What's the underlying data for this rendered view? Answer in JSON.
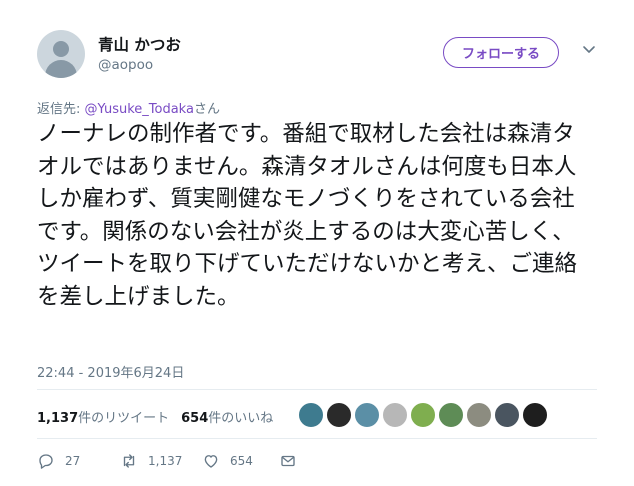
{
  "user": {
    "name": "青山 かつお",
    "handle": "@aopoo",
    "avatar_icon": "default-avatar-icon"
  },
  "follow_button": {
    "label": "フォローする",
    "color": "#794bc4"
  },
  "reply": {
    "prefix": "返信先: ",
    "mention": "@Yusuke_Todaka",
    "suffix": "さん"
  },
  "tweet": {
    "text": "ノーナレの制作者です。番組で取材した会社は森清タオルではありません。森清タオルさんは何度も日本人しか雇わず、質実剛健なモノづくりをされている会社です。関係のない会社が炎上するのは大変心苦しく、ツイートを取り下げていただけないかと考え、ご連絡を差し上げました。",
    "timestamp": "22:44 - 2019年6月24日"
  },
  "stats": {
    "retweets_count": "1,137",
    "retweets_label": "件のリツイート",
    "likes_count": "654",
    "likes_label": "件のいいね"
  },
  "likers": [
    {
      "color": "#3e7b8f"
    },
    {
      "color": "#2a2a2a"
    },
    {
      "color": "#5b8fa6"
    },
    {
      "color": "#b7b7b7"
    },
    {
      "color": "#7fae4f"
    },
    {
      "color": "#5e8c56"
    },
    {
      "color": "#8c8c80"
    },
    {
      "color": "#4a5560"
    },
    {
      "color": "#1e1e1e"
    }
  ],
  "actions": {
    "reply_count": "27",
    "retweet_count": "1,137",
    "like_count": "654"
  }
}
